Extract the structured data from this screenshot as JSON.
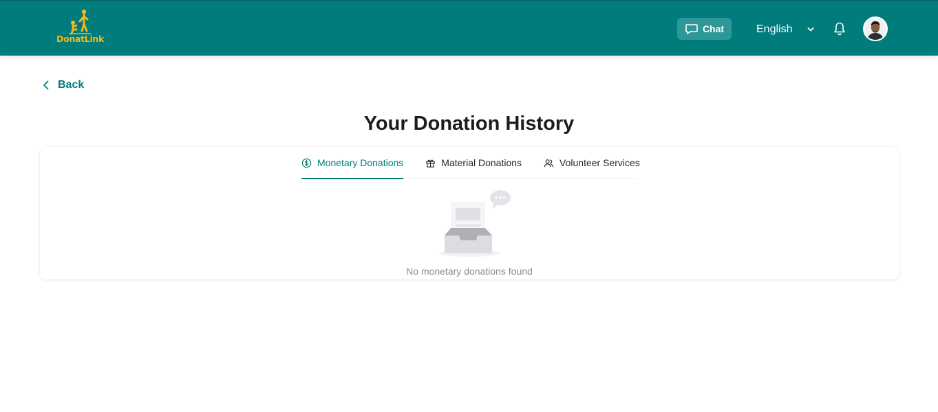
{
  "header": {
    "logo_text": "DonatLink",
    "chat_label": "Chat",
    "language": "English",
    "colors": {
      "bar": "#017c7d",
      "accent": "#f4b71a",
      "chat_bg": "#2e9899"
    },
    "icons": [
      "chat-bubble-icon",
      "chevron-down-icon",
      "bell-icon"
    ]
  },
  "back_label": "Back",
  "title": "Your Donation History",
  "tabs": [
    {
      "label": "Monetary Donations",
      "icon": "dollar-circle-icon",
      "active": true
    },
    {
      "label": "Material Donations",
      "icon": "gift-icon",
      "active": false
    },
    {
      "label": "Volunteer Services",
      "icon": "people-icon",
      "active": false
    }
  ],
  "empty_state": {
    "message": "No monetary donations found",
    "icon": "empty-inbox-icon"
  }
}
